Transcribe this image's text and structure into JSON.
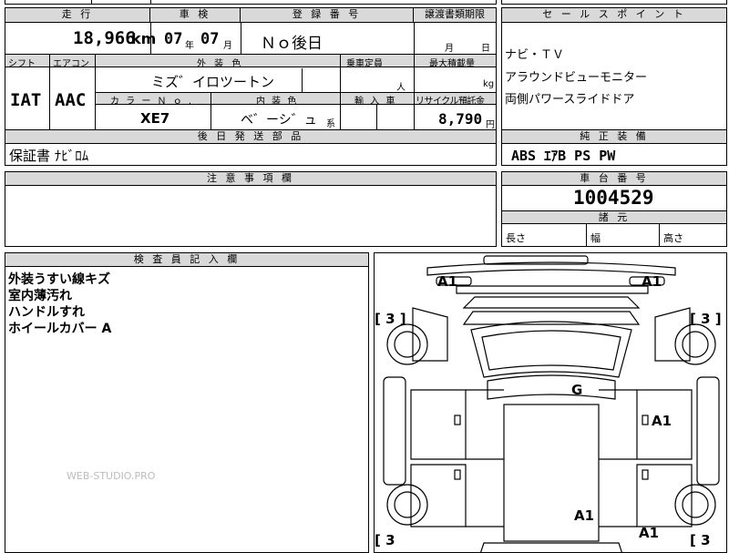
{
  "top": {
    "mileage_label": "走 行",
    "mileage_value": "18,966",
    "mileage_unit": "km",
    "inspection_label": "車 検",
    "inspection_year": "07",
    "inspection_year_unit": "年",
    "inspection_month": "07",
    "inspection_month_unit": "月",
    "registration_label": "登 録 番 号",
    "registration_value": "Ｎｏ後日",
    "transfer_label": "譲渡書類期限",
    "transfer_month": "月",
    "transfer_day": "日"
  },
  "row2": {
    "shift_label": "シフト",
    "ac_label": "エアコン",
    "exterior_label": "外 装 色",
    "capacity_label": "乗車定員",
    "maxload_label": "最大積載量",
    "shift_value": "IAT",
    "ac_value": "AAC",
    "exterior_value": "ミズ゛イロツートン",
    "capacity_unit": "人",
    "maxload_unit": "kg",
    "color_no_label": "カ ラ ー Ｎ ｏ .",
    "interior_label": "内 装 色",
    "import_label": "輸 入 車",
    "recycle_label": "リサイクル預託金",
    "color_no_value": "XE7",
    "interior_value": "ベ゛ーシ゛ュ",
    "interior_suffix": "系",
    "recycle_value": "8,790",
    "recycle_unit": "円"
  },
  "later": {
    "label": "後 日 発 送 部 品",
    "value": "保証書 ﾅﾋﾞﾛﾑ"
  },
  "notes": {
    "label": "注 意 事 項 欄"
  },
  "sales": {
    "label": "セ ー ル ス ポ イ ン ト",
    "lines": [
      "ナビ・ＴＶ",
      "アラウンドビューモニター",
      "両側パワースライドドア"
    ]
  },
  "equipment": {
    "label": "純 正 装 備",
    "value": "ABS ｴｱB PS PW"
  },
  "chassis": {
    "label": "車 台 番 号",
    "value": "1004529"
  },
  "dims": {
    "label": "諸 元",
    "length": "長さ",
    "width": "幅",
    "height": "高さ"
  },
  "inspector": {
    "label": "検 査 員 記 入 欄",
    "lines": [
      "外装うすい線キズ",
      "室内薄汚れ",
      "ハンドルすれ",
      "ホイールカバー A"
    ]
  },
  "diagram": {
    "mark_a1_fl": "A1",
    "mark_a1_fr": "A1",
    "mark_g": "G",
    "mark_a1_side": "A1",
    "mark_a1_rear": "A1",
    "mark_a1_rr": "A1",
    "tire_fl": "[ 3 ]",
    "tire_fr": "[ 3 ]",
    "tire_rl": "[ 3",
    "tire_rr": "[ 3"
  },
  "watermark": "WEB-STUDIO.PRO"
}
